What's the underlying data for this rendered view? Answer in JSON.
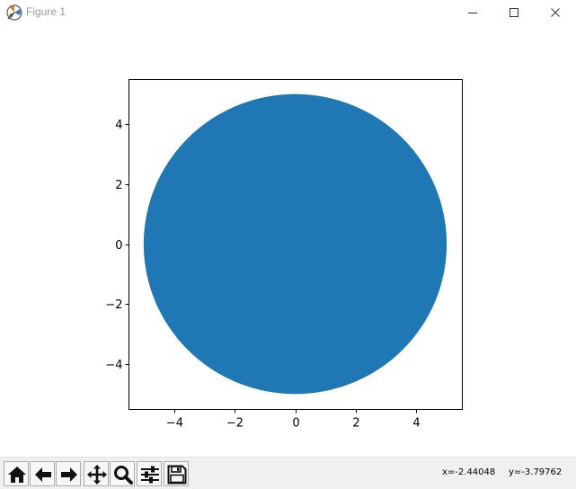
{
  "window": {
    "title": "Figure 1",
    "controls": [
      "minimize",
      "maximize",
      "close"
    ]
  },
  "toolbar": {
    "buttons": [
      {
        "name": "home",
        "icon": "home-icon"
      },
      {
        "name": "back",
        "icon": "arrow-left-icon"
      },
      {
        "name": "forward",
        "icon": "arrow-right-icon"
      },
      {
        "name": "pan",
        "icon": "move-arrows-icon"
      },
      {
        "name": "zoom",
        "icon": "magnifier-icon"
      },
      {
        "name": "configure-subplots",
        "icon": "sliders-icon"
      },
      {
        "name": "save",
        "icon": "floppy-disk-icon"
      }
    ],
    "x_readout": "x=-2.44048",
    "y_readout": "y=-3.79762"
  },
  "chart_data": {
    "type": "scatter",
    "shape": "circle",
    "center": [
      0,
      0
    ],
    "radius": 5,
    "color": "#1f77b4",
    "xlim": [
      -5.5,
      5.5
    ],
    "ylim": [
      -5.5,
      5.5
    ],
    "x_ticks": [
      -4,
      -2,
      0,
      2,
      4
    ],
    "y_ticks": [
      -4,
      -2,
      0,
      2,
      4
    ],
    "x_tick_labels": [
      "−4",
      "−2",
      "0",
      "2",
      "4"
    ],
    "y_tick_labels": [
      "−4",
      "−2",
      "0",
      "2",
      "4"
    ],
    "grid": false,
    "aspect": "equal"
  }
}
